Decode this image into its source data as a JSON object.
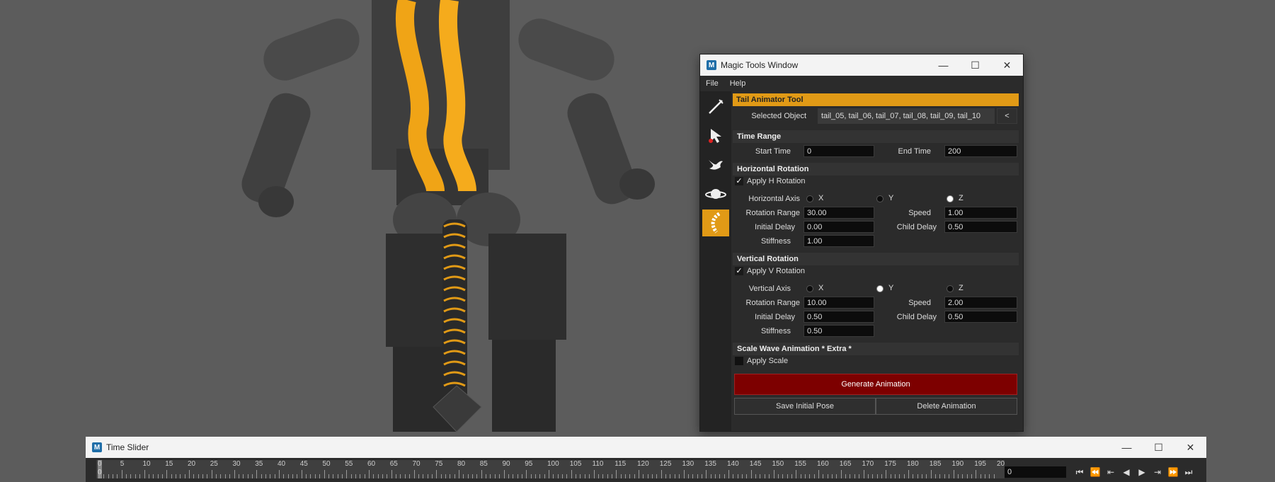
{
  "window": {
    "title": "Magic Tools Window",
    "icon_letter": "M",
    "controls": {
      "minimize": "—",
      "maximize": "☐",
      "close": "✕"
    },
    "menu": [
      "File",
      "Help"
    ]
  },
  "tools": [
    "pen-icon",
    "select-arrow-icon",
    "bird-icon",
    "planet-icon",
    "tail-icon"
  ],
  "panel": {
    "header": "Tail Animator Tool",
    "selected_object_label": "Selected Object",
    "selected_object_value": "tail_05, tail_06, tail_07, tail_08, tail_09, tail_10",
    "selected_object_button": "<",
    "time_range": {
      "title": "Time Range",
      "start_label": "Start Time",
      "start_value": "0",
      "end_label": "End Time",
      "end_value": "200"
    },
    "horizontal": {
      "title": "Horizontal Rotation",
      "apply_label": "Apply H Rotation",
      "apply_checked": "✓",
      "axis_label": "Horizontal Axis",
      "axes": [
        "X",
        "Y",
        "Z"
      ],
      "selected_axis": "Z",
      "range_label": "Rotation Range",
      "range_value": "30.00",
      "speed_label": "Speed",
      "speed_value": "1.00",
      "delay_label": "Initial Delay",
      "delay_value": "0.00",
      "child_label": "Child Delay",
      "child_value": "0.50",
      "stiff_label": "Stiffness",
      "stiff_value": "1.00"
    },
    "vertical": {
      "title": "Vertical Rotation",
      "apply_label": "Apply V Rotation",
      "apply_checked": "✓",
      "axis_label": "Vertical Axis",
      "axes": [
        "X",
        "Y",
        "Z"
      ],
      "selected_axis": "Y",
      "range_label": "Rotation Range",
      "range_value": "10.00",
      "speed_label": "Speed",
      "speed_value": "2.00",
      "delay_label": "Initial Delay",
      "delay_value": "0.50",
      "child_label": "Child Delay",
      "child_value": "0.50",
      "stiff_label": "Stiffness",
      "stiff_value": "0.50"
    },
    "scale": {
      "title": "Scale Wave Animation * Extra *",
      "apply_label": "Apply Scale"
    },
    "generate_label": "Generate Animation",
    "save_label": "Save Initial Pose",
    "delete_label": "Delete Animation"
  },
  "time_slider": {
    "title": "Time Slider",
    "current_frame": "0",
    "ticks": [
      "0",
      "5",
      "10",
      "15",
      "20",
      "25",
      "30",
      "35",
      "40",
      "45",
      "50",
      "55",
      "60",
      "65",
      "70",
      "75",
      "80",
      "85",
      "90",
      "95",
      "100",
      "105",
      "110",
      "115",
      "120",
      "125",
      "130",
      "135",
      "140",
      "145",
      "150",
      "155",
      "160",
      "165",
      "170",
      "175",
      "180",
      "185",
      "190",
      "195",
      "20"
    ],
    "playhead_label": "0",
    "controls": [
      "⏮",
      "⏪",
      "⇤",
      "◀",
      "▶",
      "⇥",
      "⏩",
      "⏭"
    ]
  },
  "colors": {
    "accent": "#e19a16",
    "generate": "#7d0000",
    "panel": "#2b2b2b"
  }
}
